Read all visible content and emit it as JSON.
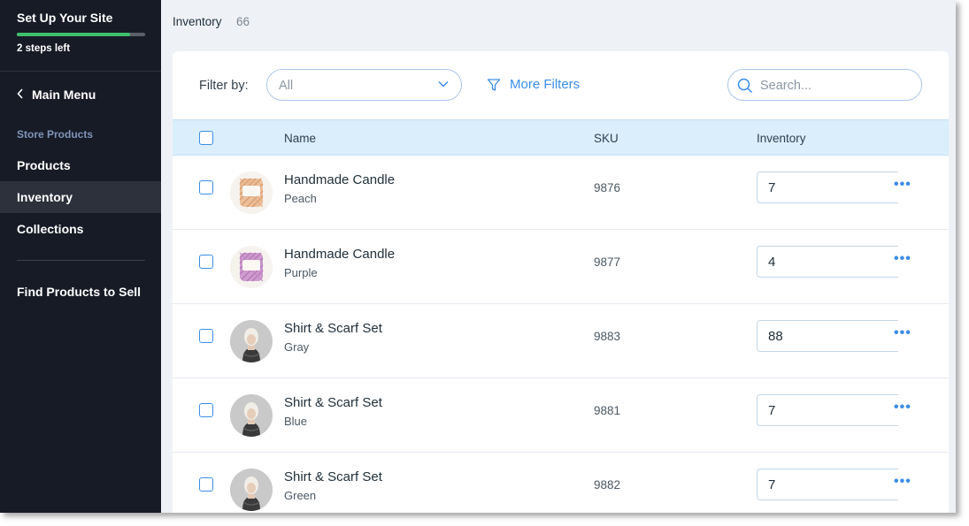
{
  "sidebar": {
    "setup_title": "Set Up Your Site",
    "setup_progress": 0.88,
    "steps_left": "2 steps left",
    "main_menu": "Main Menu",
    "section_label": "Store Products",
    "items": [
      {
        "label": "Products",
        "active": false
      },
      {
        "label": "Inventory",
        "active": true
      },
      {
        "label": "Collections",
        "active": false
      }
    ],
    "find_products": "Find Products to Sell"
  },
  "header": {
    "breadcrumb": "Inventory",
    "count": "66"
  },
  "toolbar": {
    "filter_label": "Filter by:",
    "filter_value": "All",
    "more_filters": "More Filters",
    "search_placeholder": "Search..."
  },
  "table": {
    "columns": {
      "name": "Name",
      "sku": "SKU",
      "inventory": "Inventory"
    },
    "rows": [
      {
        "name": "Handmade Candle",
        "variant": "Peach",
        "sku": "9876",
        "inventory": "7",
        "thumb": "candle-peach"
      },
      {
        "name": "Handmade Candle",
        "variant": "Purple",
        "sku": "9877",
        "inventory": "4",
        "thumb": "candle-purple"
      },
      {
        "name": "Shirt & Scarf Set",
        "variant": "Gray",
        "sku": "9883",
        "inventory": "88",
        "thumb": "person"
      },
      {
        "name": "Shirt & Scarf Set",
        "variant": "Blue",
        "sku": "9881",
        "inventory": "7",
        "thumb": "person"
      },
      {
        "name": "Shirt & Scarf Set",
        "variant": "Green",
        "sku": "9882",
        "inventory": "7",
        "thumb": "person"
      }
    ]
  },
  "colors": {
    "sidebar_bg": "#171b26",
    "accent": "#3b8de8",
    "progress": "#3fbf6b",
    "header_row": "#daeefc"
  }
}
